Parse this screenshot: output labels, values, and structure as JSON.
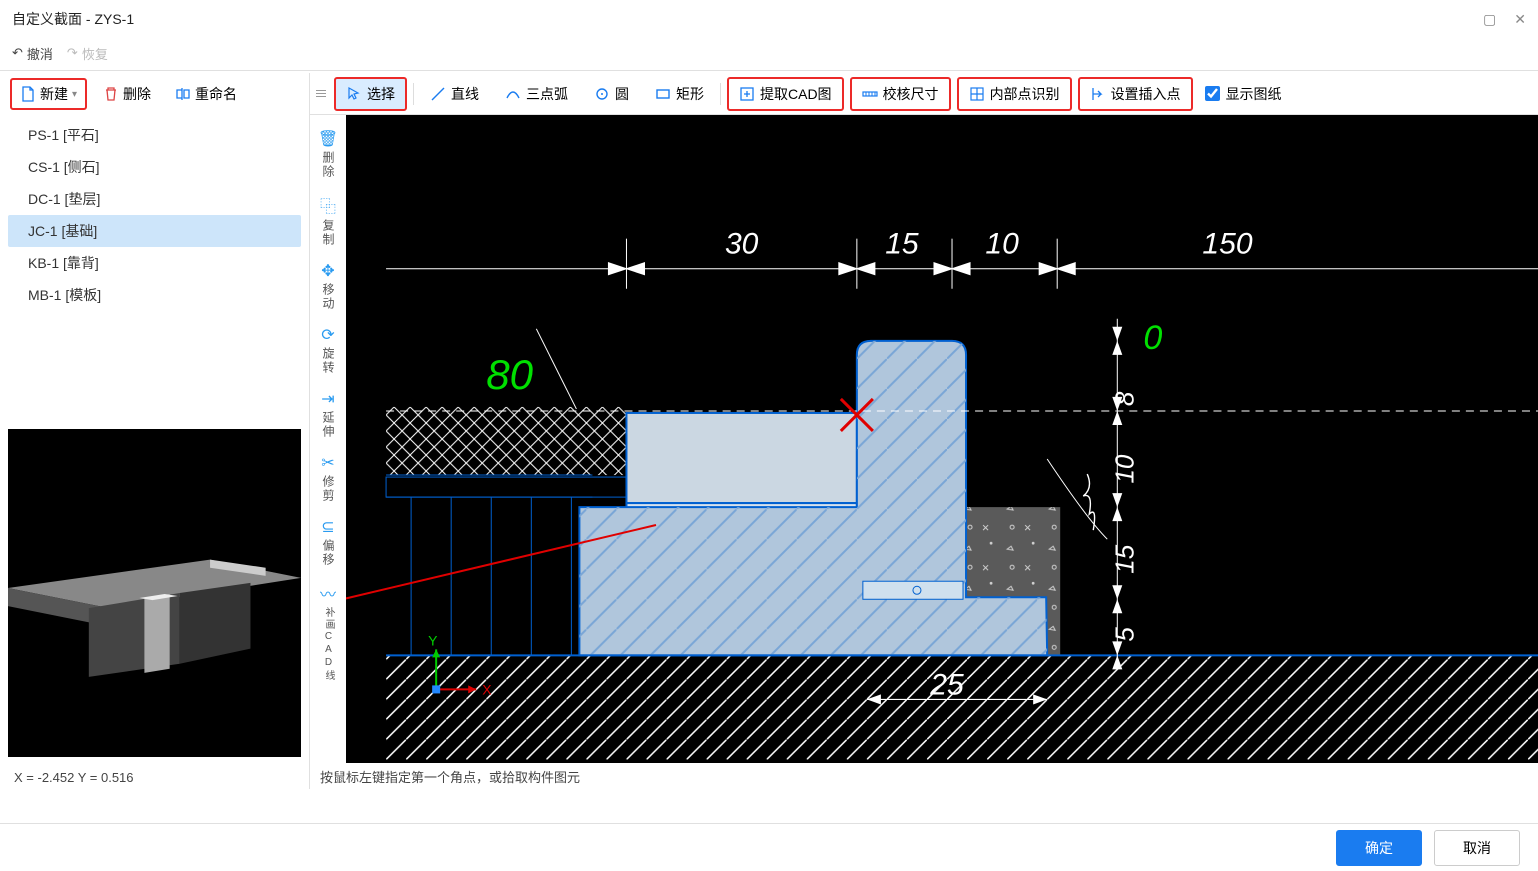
{
  "window": {
    "title": "自定义截面 - ZYS-1"
  },
  "undo_bar": {
    "undo": "撤消",
    "redo": "恢复"
  },
  "left_toolbar": {
    "new": "新建",
    "delete": "删除",
    "rename": "重命名"
  },
  "sections": {
    "items": [
      {
        "label": "PS-1 [平石]"
      },
      {
        "label": "CS-1 [侧石]"
      },
      {
        "label": "DC-1 [垫层]"
      },
      {
        "label": "JC-1 [基础]"
      },
      {
        "label": "KB-1 [靠背]"
      },
      {
        "label": "MB-1 [模板]"
      }
    ],
    "selected_index": 3
  },
  "coord_status": "X = -2.452 Y = 0.516",
  "draw_toolbar": {
    "select": "选择",
    "line": "直线",
    "arc3": "三点弧",
    "circle": "圆",
    "rect": "矩形",
    "extract_cad": "提取CAD图",
    "verify_dim": "校核尺寸",
    "inner_point": "内部点识别",
    "set_insert": "设置插入点",
    "show_drawing": "显示图纸"
  },
  "side_tools": {
    "delete": "删除",
    "copy": "复制",
    "move": "移动",
    "rotate": "旋转",
    "extend": "延伸",
    "trim": "修剪",
    "offset": "偏移",
    "align_cad": "补画CAD线"
  },
  "canvas": {
    "dim_top_1": "30",
    "dim_top_2": "15",
    "dim_top_3": "10",
    "dim_top_4": "150",
    "dim_left_angle": "80",
    "dim_right_0": "0",
    "dim_right_1": "8",
    "dim_right_2": "10",
    "dim_right_3": "15",
    "dim_right_4": "5",
    "dim_bottom": "25",
    "axis_x": "X",
    "axis_y": "Y"
  },
  "prompt": "按鼠标左键指定第一个角点，或拾取构件图元",
  "buttons": {
    "ok": "确定",
    "cancel": "取消"
  }
}
